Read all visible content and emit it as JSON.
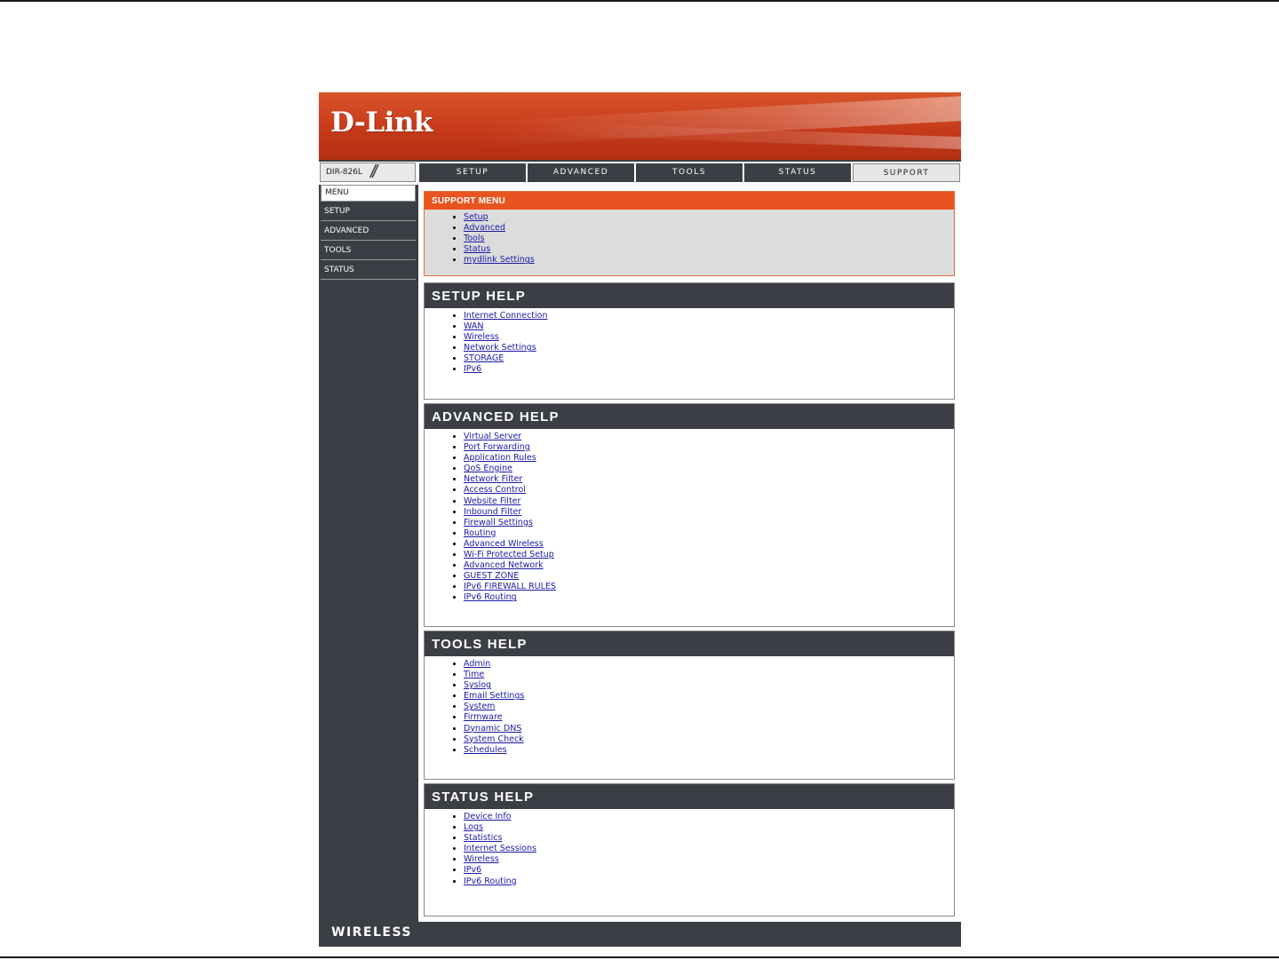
{
  "header": {
    "logo": "D-Link"
  },
  "model": "DIR-826L",
  "tabs": [
    {
      "label": "SETUP"
    },
    {
      "label": "ADVANCED"
    },
    {
      "label": "TOOLS"
    },
    {
      "label": "STATUS"
    },
    {
      "label": "SUPPORT",
      "active": true
    }
  ],
  "sidebar": {
    "items": [
      {
        "label": "MENU"
      },
      {
        "label": "SETUP"
      },
      {
        "label": "ADVANCED"
      },
      {
        "label": "TOOLS"
      },
      {
        "label": "STATUS"
      }
    ],
    "footer": "WIRELESS"
  },
  "sections": [
    {
      "title": "SUPPORT MENU",
      "links": [
        "Setup",
        "Advanced",
        "Tools",
        "Status",
        "mydlink Settings"
      ]
    },
    {
      "title": "SETUP HELP",
      "links": [
        "Internet Connection",
        "WAN",
        "Wireless",
        "Network Settings",
        "STORAGE",
        "IPv6"
      ]
    },
    {
      "title": "ADVANCED HELP",
      "links": [
        "Virtual Server",
        "Port Forwarding",
        "Application Rules",
        "QoS Engine",
        "Network Filter",
        "Access Control",
        "Website Filter",
        "Inbound Filter",
        "Firewall Settings",
        "Routing",
        "Advanced Wireless",
        "Wi-Fi Protected Setup",
        "Advanced Network",
        "GUEST ZONE",
        "IPv6 FIREWALL RULES",
        "IPv6 Routing"
      ]
    },
    {
      "title": "TOOLS HELP",
      "links": [
        "Admin",
        "Time",
        "Syslog",
        "Email Settings",
        "System",
        "Firmware",
        "Dynamic DNS",
        "System Check",
        "Schedules"
      ]
    },
    {
      "title": "STATUS HELP",
      "links": [
        "Device Info",
        "Logs",
        "Statistics",
        "Internet Sessions",
        "Wireless",
        "IPv6",
        "IPv6 Routing"
      ]
    }
  ],
  "colors": {
    "brand_orange": "#c63a1a",
    "dark_gray": "#3b3e44",
    "link_blue": "#1a1aa6"
  }
}
